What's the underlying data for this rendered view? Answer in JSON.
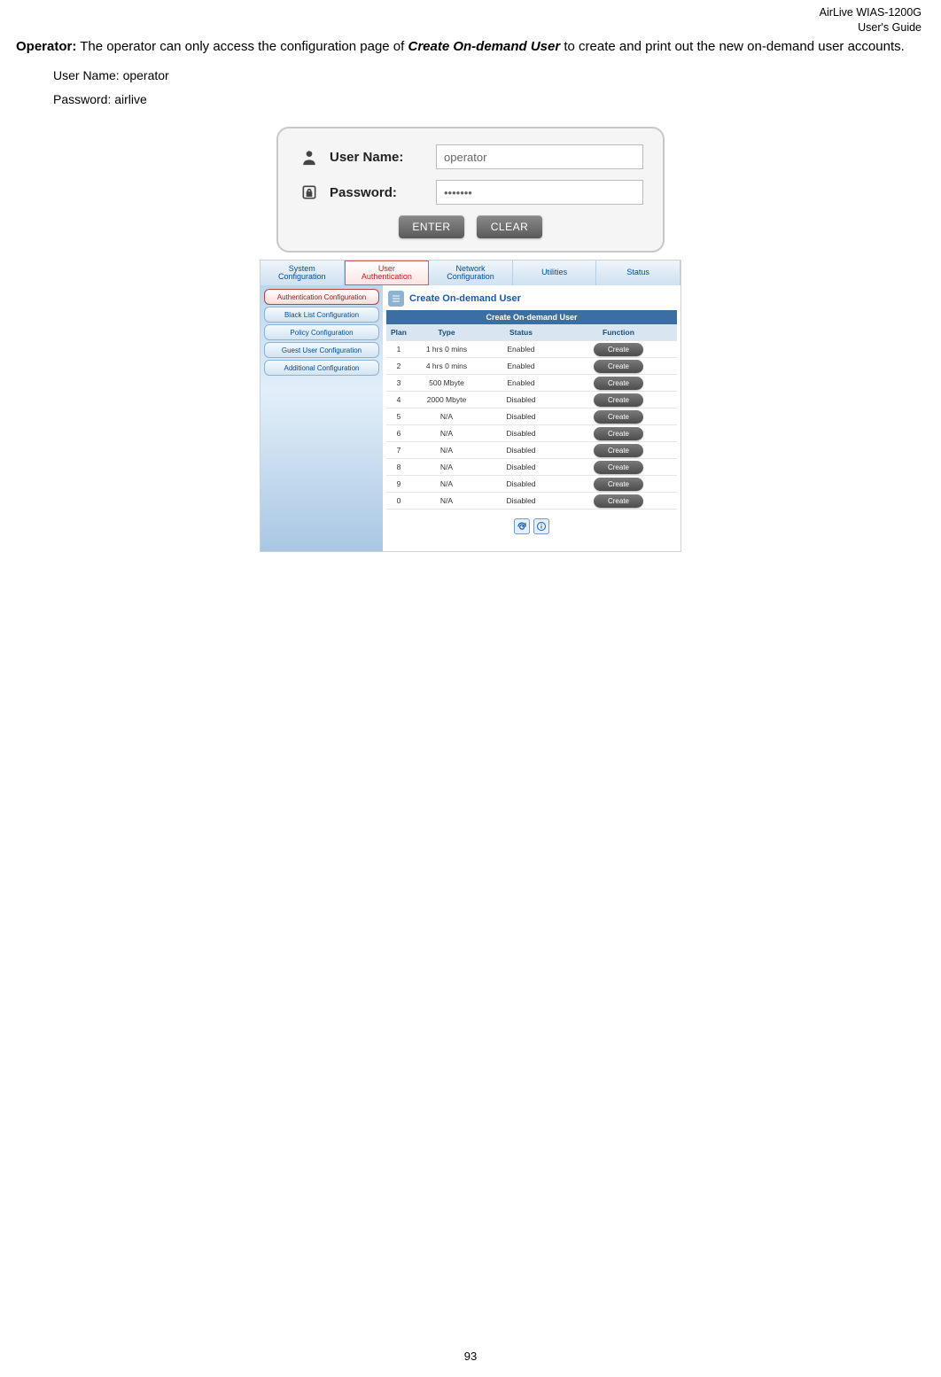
{
  "header": {
    "product": "AirLive WIAS-1200G",
    "doc": "User's Guide"
  },
  "intro": {
    "operator_label": "Operator:",
    "text_part1": " The operator can only access the configuration page of ",
    "emph": "Create On-demand User",
    "text_part2": " to create and print out the new on-demand user accounts.",
    "user_line_label": "User Name: ",
    "user_line_value": "operator",
    "pass_line_label": "Password: ",
    "pass_line_value": "airlive"
  },
  "login": {
    "user_label": "User Name:",
    "user_value": "operator",
    "pass_label": "Password:",
    "pass_value": "•••••••",
    "enter": "ENTER",
    "clear": "CLEAR"
  },
  "tabs": [
    {
      "label": "System\nConfiguration"
    },
    {
      "label": "User\nAuthentication"
    },
    {
      "label": "Network\nConfiguration"
    },
    {
      "label": "Utilities"
    },
    {
      "label": "Status"
    }
  ],
  "sidebar": [
    {
      "label": "Authentication Configuration",
      "active": true
    },
    {
      "label": "Black List Configuration"
    },
    {
      "label": "Policy Configuration"
    },
    {
      "label": "Guest User Configuration"
    },
    {
      "label": "Additional Configuration"
    }
  ],
  "page_heading": "Create On-demand User",
  "table": {
    "title": "Create On-demand User",
    "headers": {
      "plan": "Plan",
      "type": "Type",
      "status": "Status",
      "func": "Function"
    },
    "rows": [
      {
        "plan": "1",
        "type": "1 hrs 0 mins",
        "status": "Enabled"
      },
      {
        "plan": "2",
        "type": "4 hrs 0 mins",
        "status": "Enabled"
      },
      {
        "plan": "3",
        "type": "500 Mbyte",
        "status": "Enabled"
      },
      {
        "plan": "4",
        "type": "2000 Mbyte",
        "status": "Disabled"
      },
      {
        "plan": "5",
        "type": "N/A",
        "status": "Disabled"
      },
      {
        "plan": "6",
        "type": "N/A",
        "status": "Disabled"
      },
      {
        "plan": "7",
        "type": "N/A",
        "status": "Disabled"
      },
      {
        "plan": "8",
        "type": "N/A",
        "status": "Disabled"
      },
      {
        "plan": "9",
        "type": "N/A",
        "status": "Disabled"
      },
      {
        "plan": "0",
        "type": "N/A",
        "status": "Disabled"
      }
    ],
    "create_label": "Create"
  },
  "page_number": "93"
}
